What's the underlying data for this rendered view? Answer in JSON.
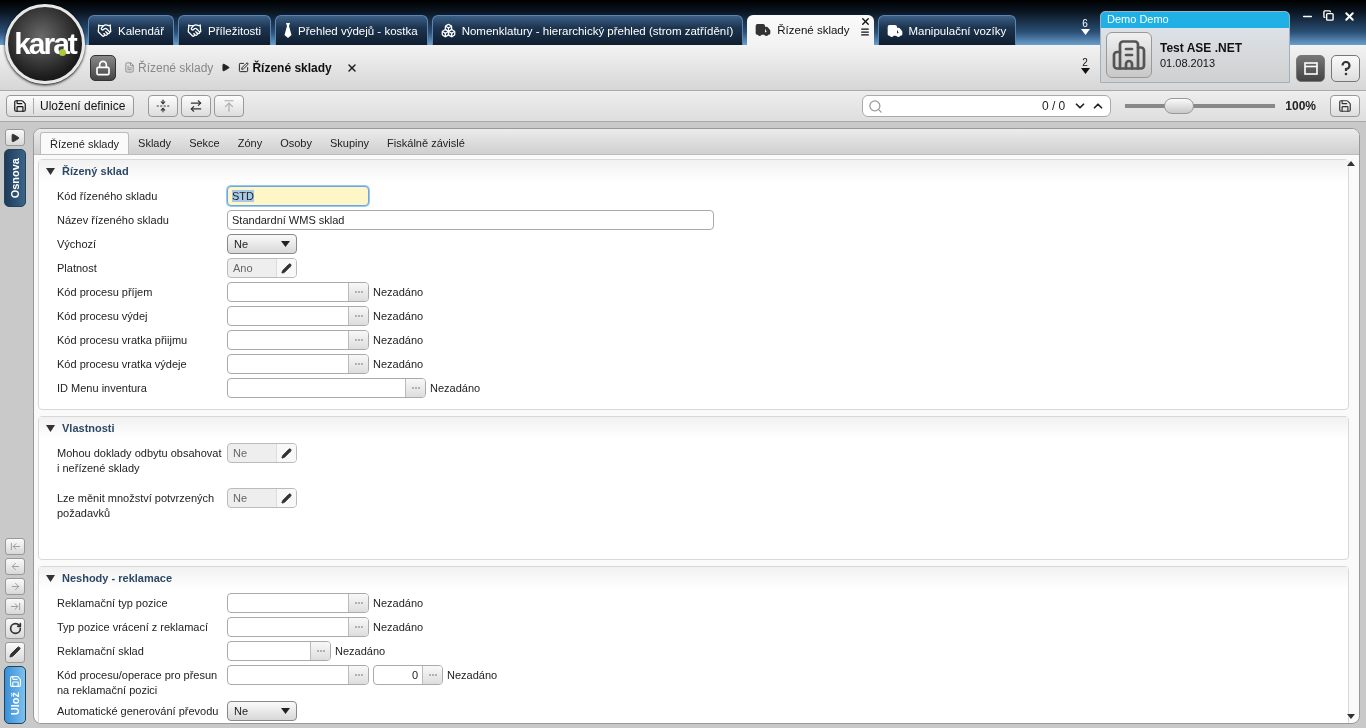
{
  "logo": "karat",
  "app_tabs": [
    {
      "label": "Kalendář",
      "kind": "people",
      "selected": false
    },
    {
      "label": "Příležitosti",
      "kind": "people",
      "selected": false
    },
    {
      "label": "Přehled výdejů - kostka",
      "kind": "tie",
      "selected": false
    },
    {
      "label": "Nomenklatury - hierarchický přehled (strom zatřídění)",
      "kind": "boxes",
      "selected": false
    },
    {
      "label": "Řízené sklady",
      "kind": "truck",
      "selected": true
    },
    {
      "label": "Manipulační vozíky",
      "kind": "truck",
      "selected": false
    }
  ],
  "tab_count": "6",
  "history_count": "2",
  "user": {
    "name": "Demo Demo",
    "company": "Test ASE .NET",
    "date": "01.08.2013"
  },
  "breadcrumb": [
    {
      "label": "Řízené sklady",
      "kind": "list",
      "selected": false
    },
    {
      "label": "Řízené sklady",
      "kind": "edit",
      "selected": true
    }
  ],
  "toolbar": {
    "save_label": "Uložení definice",
    "search": {
      "count": "0 / 0"
    },
    "zoom": {
      "level": 0.36,
      "reading": "100%"
    }
  },
  "side_rail": {
    "outline_label": "Osnova",
    "save_label": "Ulož"
  },
  "form_tabs": [
    {
      "label": "Řízené sklady",
      "selected": true
    },
    {
      "label": "Sklady",
      "selected": false
    },
    {
      "label": "Sekce",
      "selected": false
    },
    {
      "label": "Zóny",
      "selected": false
    },
    {
      "label": "Osoby",
      "selected": false
    },
    {
      "label": "Skupiny",
      "selected": false
    },
    {
      "label": "Fiskálně závislé",
      "selected": false
    }
  ],
  "sections": [
    {
      "title": "Řízený sklad",
      "expanded": true,
      "fields": [
        {
          "label": "Kód řízeného skladu",
          "kind": "text",
          "value": "STD",
          "focused": true
        },
        {
          "label": "Název řízeného skladu",
          "kind": "text-wide",
          "value": "Standardní WMS sklad",
          "focused": false
        },
        {
          "label": "Výchozí",
          "kind": "select",
          "value": "Ne",
          "focused": false
        },
        {
          "label": "Platnost",
          "kind": "toggle",
          "value": "Ano",
          "focused": false
        },
        {
          "label": "Kód procesu příjem",
          "kind": "lookup",
          "note": "Nezadáno",
          "focused": false
        },
        {
          "label": "Kód procesu výdej",
          "kind": "lookup",
          "note": "Nezadáno",
          "focused": false
        },
        {
          "label": "Kód procesu vratka přiijmu",
          "kind": "lookup",
          "note": "Nezadáno",
          "focused": false
        },
        {
          "label": "Kód procesu vratka výdeje",
          "kind": "lookup",
          "note": "Nezadáno",
          "focused": false
        },
        {
          "label": "ID Menu inventura",
          "kind": "lookup-long",
          "note": "Nezadáno",
          "focused": false
        }
      ]
    },
    {
      "title": "Vlastnosti",
      "expanded": true,
      "fields": [
        {
          "label": "Mohou doklady odbytu obsahovat i neřízené sklady",
          "kind": "toggle",
          "value": "Ne",
          "focused": false
        },
        {
          "label": "Lze měnit množství potvrzených požadavků",
          "kind": "toggle",
          "value": "Ne",
          "focused": false
        }
      ]
    },
    {
      "title": "Neshody - reklamace",
      "expanded": true,
      "fields": [
        {
          "label": "Reklamační typ pozice",
          "kind": "lookup",
          "note": "Nezadáno",
          "focused": false
        },
        {
          "label": "Typ pozice vrácení z reklamací",
          "kind": "lookup",
          "note": "Nezadáno",
          "focused": false
        },
        {
          "label": "Reklamační sklad",
          "kind": "lookup-short",
          "note": "Nezadáno",
          "focused": false
        },
        {
          "label": "Kód procesu/operace pro přesun na reklamační pozici",
          "kind": "lookup-double",
          "value": "0",
          "note": "Nezadáno",
          "focused": false
        },
        {
          "label": "Automatické generování převodu",
          "kind": "select",
          "value": "Ne",
          "focused": false
        }
      ]
    }
  ]
}
